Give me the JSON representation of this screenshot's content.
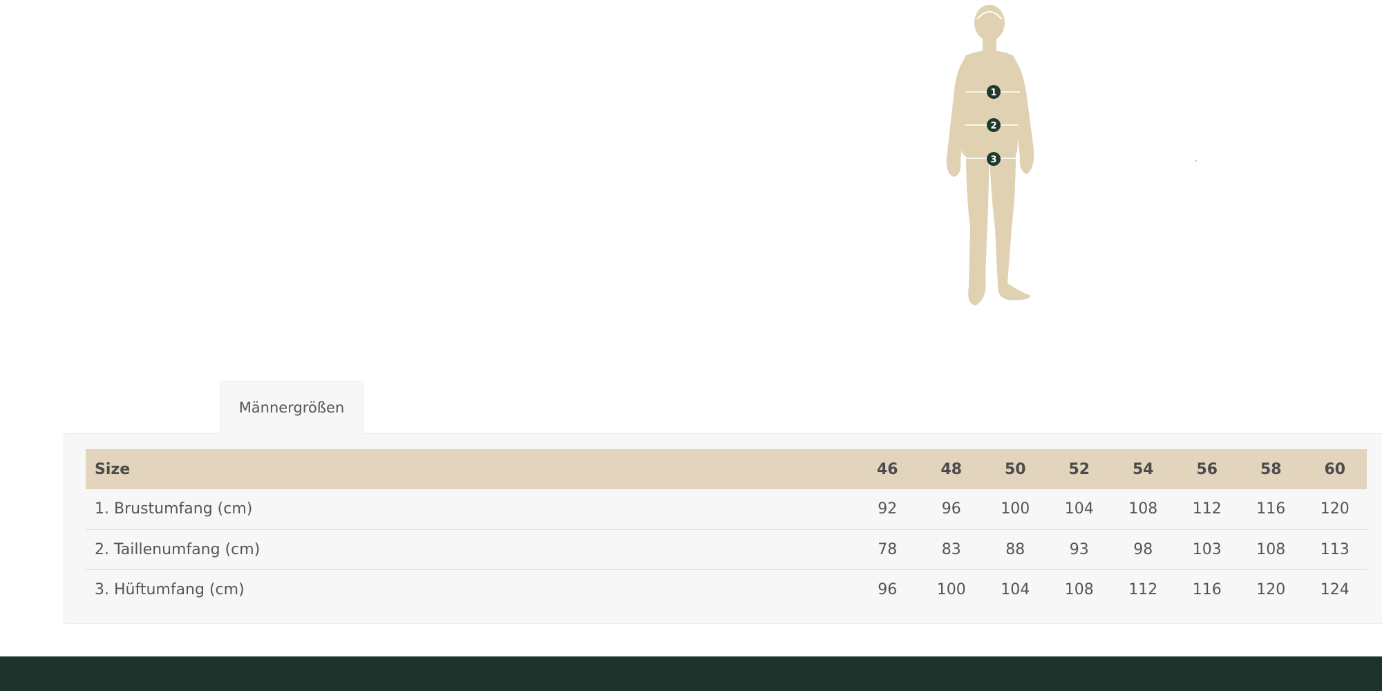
{
  "figure": {
    "icon": "body-measurement-figure-icon",
    "body_color": "#e0d1b3",
    "marker_color": "#1d3b2e",
    "markers": [
      "1",
      "2",
      "3"
    ]
  },
  "tabs": [
    {
      "label": "Männergrößen",
      "active": true
    }
  ],
  "table": {
    "header_label": "Size",
    "sizes": [
      "46",
      "48",
      "50",
      "52",
      "54",
      "56",
      "58",
      "60"
    ],
    "rows": [
      {
        "label": "1. Brustumfang (cm)",
        "values": [
          "92",
          "96",
          "100",
          "104",
          "108",
          "112",
          "116",
          "120"
        ]
      },
      {
        "label": "2. Taillenumfang (cm)",
        "values": [
          "78",
          "83",
          "88",
          "93",
          "98",
          "103",
          "108",
          "113"
        ]
      },
      {
        "label": "3. Hüftumfang (cm)",
        "values": [
          "96",
          "100",
          "104",
          "108",
          "112",
          "116",
          "120",
          "124"
        ]
      }
    ]
  },
  "colors": {
    "header_bg": "#e2d4bd",
    "panel_bg": "#f7f7f7",
    "footer_bg": "#1d322a"
  }
}
